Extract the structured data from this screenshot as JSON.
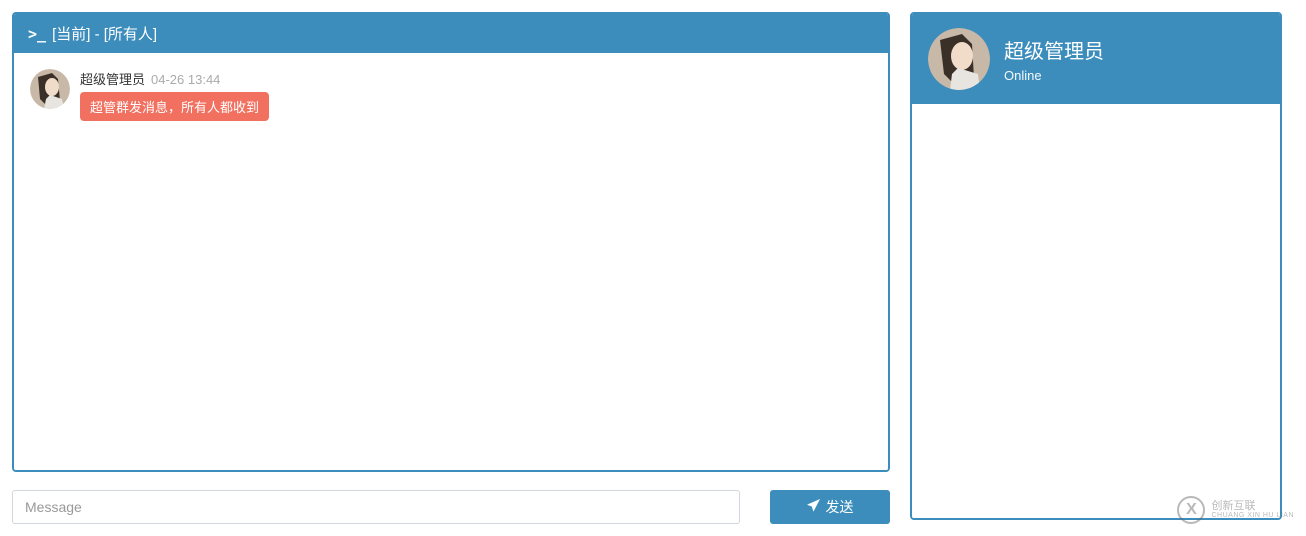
{
  "chat": {
    "header_title": "[当前] - [所有人]",
    "terminal_glyph": ">_"
  },
  "messages": [
    {
      "sender": "超级管理员",
      "timestamp": "04-26 13:44",
      "body": "超管群发消息，所有人都收到"
    }
  ],
  "input": {
    "placeholder": "Message",
    "send_label": "发送"
  },
  "user_card": {
    "name": "超级管理员",
    "status": "Online"
  },
  "watermark": {
    "logo_letter": "X",
    "text_main": "创新互联",
    "text_sub": "CHUANG XIN HU LIAN"
  },
  "colors": {
    "primary": "#3c8dbc",
    "bubble": "#f17060"
  }
}
